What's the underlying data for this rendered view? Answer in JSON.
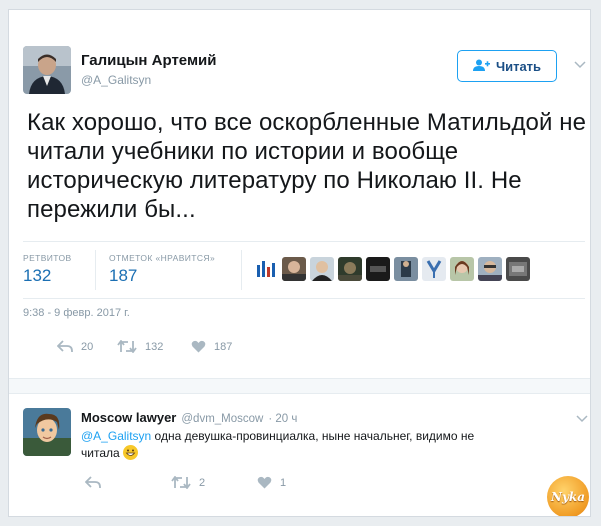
{
  "tweet": {
    "author_name": "Галицын Артемий",
    "author_handle": "@A_Galitsyn",
    "follow_label": "Читать",
    "text": "Как хорошо, что все оскорбленные Матильдой не читали учебники по истории и вообще историческую литературу по Николаю II. Не пережили бы...",
    "retweets_label": "РЕТВИТОВ",
    "retweets_count": "132",
    "likes_label": "ОТМЕТОК «НРАВИТСЯ»",
    "likes_count": "187",
    "timestamp": "9:38 - 9 февр. 2017 г.",
    "actions": {
      "reply_count": "20",
      "retweet_count": "132",
      "like_count": "187"
    },
    "liker_avatars": [
      "liker-1",
      "liker-2",
      "liker-3",
      "liker-4",
      "liker-5",
      "liker-6",
      "liker-7",
      "liker-8",
      "liker-9",
      "liker-10"
    ]
  },
  "reply": {
    "author_name": "Moscow lawyer",
    "author_handle": "@dvm_Moscow",
    "time": "· 20 ч",
    "mention": "@A_Galitsyn",
    "text": " одна девушка-провинциалка, ныне начальнег, видимо не читала",
    "actions": {
      "retweet_count": "2",
      "like_count": "1"
    }
  },
  "watermark": {
    "text": "Nyka"
  },
  "colors": {
    "accent": "#1da1f2",
    "link": "#1b6fb3",
    "muted": "#8899a6",
    "text": "#14171a"
  }
}
